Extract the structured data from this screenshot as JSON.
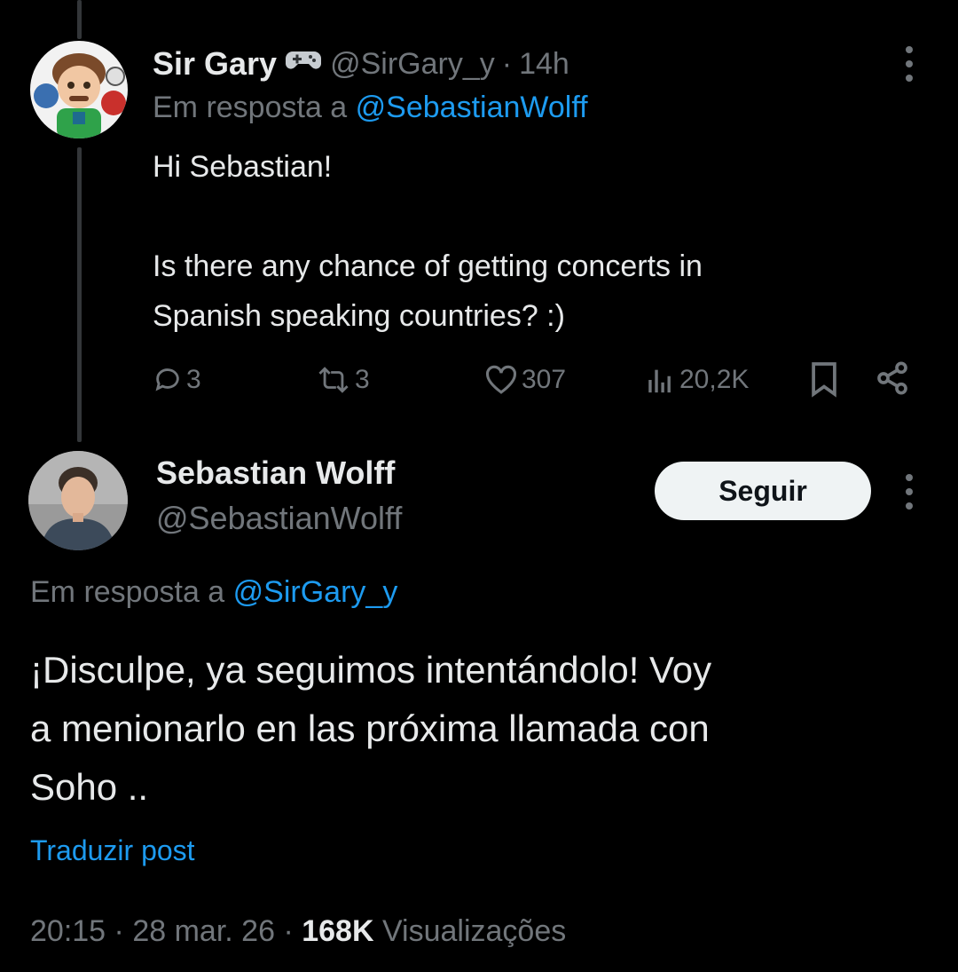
{
  "reply_tweet": {
    "name": "Sir Gary",
    "badge_icon": "gamepad-icon",
    "handle": "@SirGary_y",
    "separator": "·",
    "time": "14h",
    "reply_prefix": "Em resposta a",
    "reply_mention": "@SebastianWolff",
    "text_line1": "Hi Sebastian!",
    "text_line2": "Is there any chance of getting concerts in",
    "text_line3": "Spanish speaking countries? :)",
    "actions": {
      "replies": "3",
      "reposts": "3",
      "likes": "307",
      "views": "20,2K"
    }
  },
  "main_tweet": {
    "name": "Sebastian Wolff",
    "handle": "@SebastianWolff",
    "follow_label": "Seguir",
    "reply_prefix": "Em resposta a",
    "reply_mention": "@SirGary_y",
    "text_line1": "¡Disculpe, ya seguimos intentándolo! Voy",
    "text_line2": "a menionarlo en las próxima llamada con",
    "text_line3": "Soho ..",
    "translate_label": "Traduzir post",
    "time": "20:15",
    "date": "28 mar. 26",
    "separator": "·",
    "views_count": "168K",
    "views_label": "Visualizações"
  },
  "colors": {
    "background": "#000000",
    "text": "#e7e9ea",
    "muted": "#71767b",
    "link": "#1d9bf0",
    "thread_line": "#333639",
    "button_bg": "#eff3f4"
  }
}
